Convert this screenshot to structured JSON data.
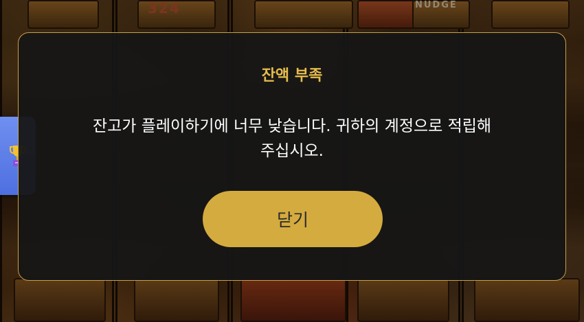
{
  "background": {
    "reel_top_texts": [
      "324",
      "NUDGE"
    ]
  },
  "side_tab": {
    "icon": "trophy-icon"
  },
  "dialog": {
    "title": "잔액 부족",
    "message_line1": "잔고가 플레이하기에 너무 낮습니다. 귀하의 계정으로 적립해",
    "message_line2": "주십시오.",
    "close_label": "닫기"
  },
  "colors": {
    "accent": "#d4ab3e",
    "title": "#e8bd4e",
    "border": "#c7a14a",
    "side_tab": "#5b7be8"
  }
}
